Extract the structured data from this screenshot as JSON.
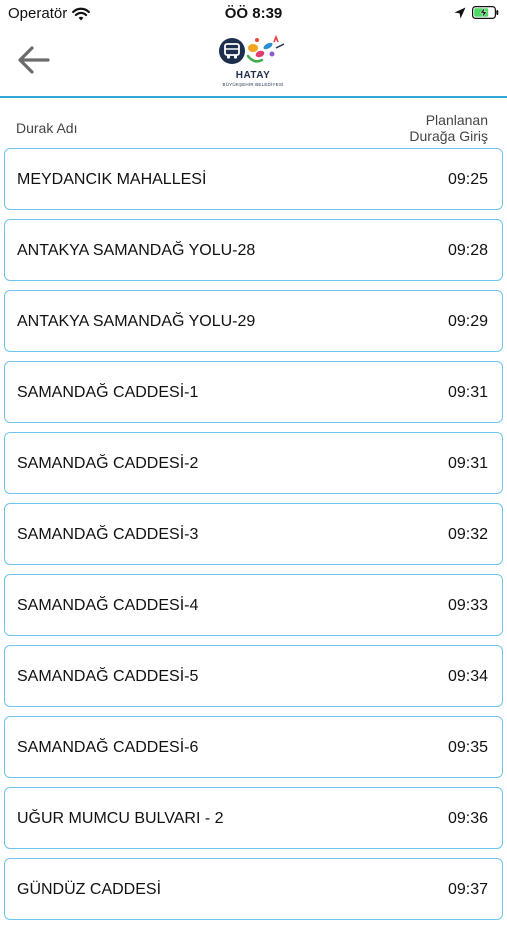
{
  "status_bar": {
    "carrier": "Operatör",
    "time": "ÖÖ 8:39"
  },
  "nav": {
    "logo_title": "HATAY",
    "logo_subtitle": "BÜYÜKŞEHİR BELEDİYESİ"
  },
  "table": {
    "col_stop": "Durak Adı",
    "col_time_line1": "Planlanan",
    "col_time_line2": "Durağa Giriş"
  },
  "stops": [
    {
      "name": "MEYDANCIK MAHALLESİ",
      "time": "09:25"
    },
    {
      "name": "ANTAKYA SAMANDAĞ YOLU-28",
      "time": "09:28"
    },
    {
      "name": "ANTAKYA SAMANDAĞ YOLU-29",
      "time": "09:29"
    },
    {
      "name": "SAMANDAĞ CADDESİ-1",
      "time": "09:31"
    },
    {
      "name": "SAMANDAĞ CADDESİ-2",
      "time": "09:31"
    },
    {
      "name": "SAMANDAĞ CADDESİ-3",
      "time": "09:32"
    },
    {
      "name": "SAMANDAĞ CADDESİ-4",
      "time": "09:33"
    },
    {
      "name": "SAMANDAĞ CADDESİ-5",
      "time": "09:34"
    },
    {
      "name": "SAMANDAĞ CADDESİ-6",
      "time": "09:35"
    },
    {
      "name": "UĞUR MUMCU BULVARI - 2",
      "time": "09:36"
    },
    {
      "name": "GÜNDÜZ CADDESİ",
      "time": "09:37"
    }
  ],
  "colors": {
    "accent": "#32a8d6",
    "row_border": "#6cc7ea",
    "battery": "#4cd964"
  },
  "icons": {
    "wifi": "wifi-icon",
    "location": "location-arrow-icon",
    "battery": "battery-charging-icon",
    "back": "back-arrow-icon",
    "bus": "bus-icon"
  }
}
